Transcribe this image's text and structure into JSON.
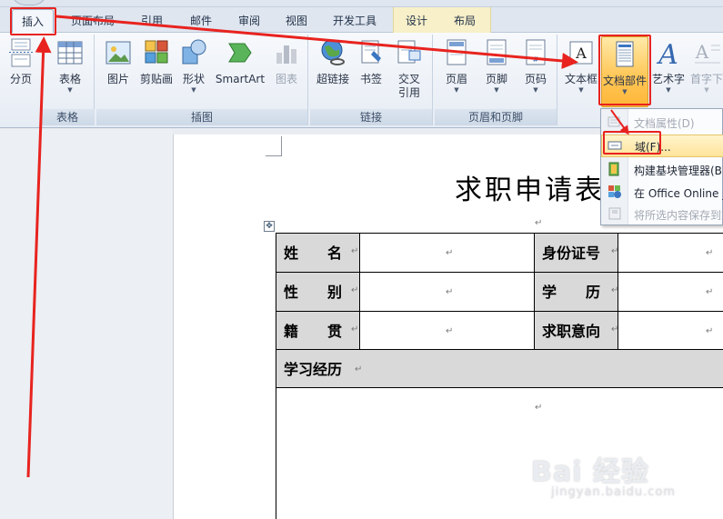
{
  "tabs": [
    {
      "label": "插入",
      "active": true
    },
    {
      "label": "页面布局"
    },
    {
      "label": "引用"
    },
    {
      "label": "邮件"
    },
    {
      "label": "审阅"
    },
    {
      "label": "视图"
    },
    {
      "label": "开发工具"
    },
    {
      "label": "设计"
    },
    {
      "label": "布局"
    }
  ],
  "ribbon": {
    "groups": {
      "table": "表格",
      "illustrations": "插图",
      "links": "链接",
      "header_footer": "页眉和页脚"
    },
    "buttons": {
      "page_break": "分页",
      "table": "表格",
      "picture": "图片",
      "clip_art": "剪贴画",
      "shapes": "形状",
      "smartart": "SmartArt",
      "chart": "图表",
      "hyperlink": "超链接",
      "bookmark": "书签",
      "cross_ref_1": "交叉",
      "cross_ref_2": "引用",
      "header": "页眉",
      "footer": "页脚",
      "page_number": "页码",
      "text_box": "文本框",
      "quick_parts": "文档部件",
      "wordart": "艺术字",
      "drop_cap": "首字下"
    }
  },
  "dropdown": {
    "items": [
      {
        "label": "文档属性(D)",
        "disabled": true
      },
      {
        "label": "域(F)...",
        "highlight": true
      },
      {
        "label": "构建基块管理器(B)"
      },
      {
        "label": "在 Office Online _"
      },
      {
        "label": "将所选内容保存到文",
        "disabled": true
      }
    ]
  },
  "document": {
    "title": "求职申请表",
    "paragraph_mark": "↵",
    "anchor_icon": "move-handle",
    "table": {
      "name_label": "姓　　名",
      "id_label": "身份证号",
      "gender_label": "性　　别",
      "education_label": "学　　历",
      "origin_label": "籍　　贯",
      "job_label": "求职意向",
      "study_label": "学习经历"
    }
  },
  "watermark": {
    "logo": "Bai 经验",
    "url": "jingyan.baidu.com"
  },
  "colors": {
    "annotation_red": "#e8231f",
    "highlight_orange": "#ffc85a"
  }
}
